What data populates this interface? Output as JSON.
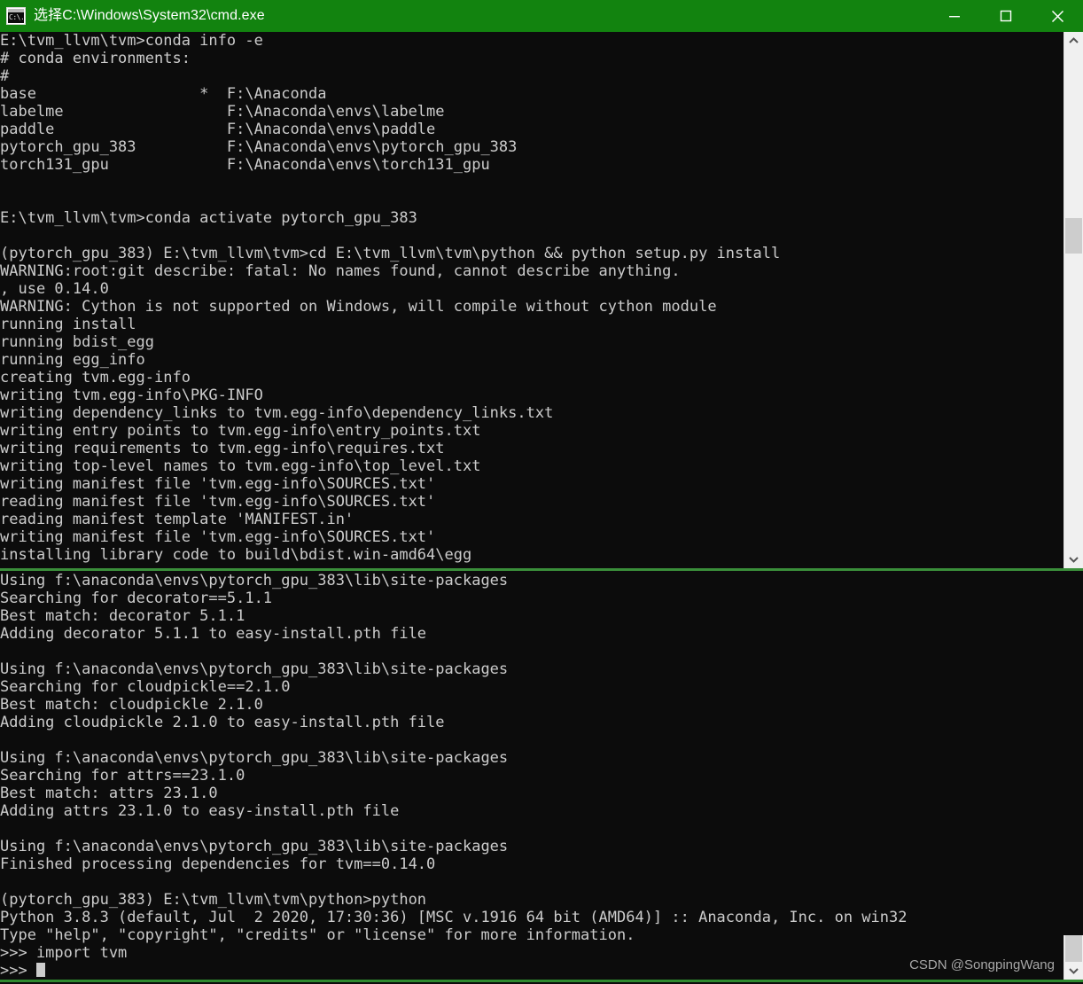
{
  "window": {
    "title": "选择C:\\Windows\\System32\\cmd.exe",
    "icon": "console-icon",
    "titlebar_color": "#12830f",
    "background_color": "#0c0c0c",
    "text_color": "#cccccc",
    "controls": [
      {
        "name": "minimize",
        "glyph": "minimize-icon"
      },
      {
        "name": "maximize",
        "glyph": "maximize-icon"
      },
      {
        "name": "close",
        "glyph": "close-icon"
      }
    ]
  },
  "divider": {
    "color": "#3a8f3a"
  },
  "scrollbars": {
    "top": {
      "up_arrow": "chevron-up-icon",
      "down_arrow": "chevron-down-icon",
      "thumb_position_pct": 36
    },
    "bottom": {
      "down_arrow": "chevron-down-icon"
    }
  },
  "watermark": {
    "text": "CSDN @SongpingWang"
  },
  "console_top": {
    "lines": [
      "E:\\tvm_llvm\\tvm>conda info -e",
      "# conda environments:",
      "#",
      "base                  *  F:\\Anaconda",
      "labelme                  F:\\Anaconda\\envs\\labelme",
      "paddle                   F:\\Anaconda\\envs\\paddle",
      "pytorch_gpu_383          F:\\Anaconda\\envs\\pytorch_gpu_383",
      "torch131_gpu             F:\\Anaconda\\envs\\torch131_gpu",
      "",
      "",
      "E:\\tvm_llvm\\tvm>conda activate pytorch_gpu_383",
      "",
      "(pytorch_gpu_383) E:\\tvm_llvm\\tvm>cd E:\\tvm_llvm\\tvm\\python && python setup.py install",
      "WARNING:root:git describe: fatal: No names found, cannot describe anything.",
      ", use 0.14.0",
      "WARNING: Cython is not supported on Windows, will compile without cython module",
      "running install",
      "running bdist_egg",
      "running egg_info",
      "creating tvm.egg-info",
      "writing tvm.egg-info\\PKG-INFO",
      "writing dependency_links to tvm.egg-info\\dependency_links.txt",
      "writing entry points to tvm.egg-info\\entry_points.txt",
      "writing requirements to tvm.egg-info\\requires.txt",
      "writing top-level names to tvm.egg-info\\top_level.txt",
      "writing manifest file 'tvm.egg-info\\SOURCES.txt'",
      "reading manifest file 'tvm.egg-info\\SOURCES.txt'",
      "reading manifest template 'MANIFEST.in'",
      "writing manifest file 'tvm.egg-info\\SOURCES.txt'",
      "installing library code to build\\bdist.win-amd64\\egg"
    ]
  },
  "console_bottom": {
    "lines": [
      "Using f:\\anaconda\\envs\\pytorch_gpu_383\\lib\\site-packages",
      "Searching for decorator==5.1.1",
      "Best match: decorator 5.1.1",
      "Adding decorator 5.1.1 to easy-install.pth file",
      "",
      "Using f:\\anaconda\\envs\\pytorch_gpu_383\\lib\\site-packages",
      "Searching for cloudpickle==2.1.0",
      "Best match: cloudpickle 2.1.0",
      "Adding cloudpickle 2.1.0 to easy-install.pth file",
      "",
      "Using f:\\anaconda\\envs\\pytorch_gpu_383\\lib\\site-packages",
      "Searching for attrs==23.1.0",
      "Best match: attrs 23.1.0",
      "Adding attrs 23.1.0 to easy-install.pth file",
      "",
      "Using f:\\anaconda\\envs\\pytorch_gpu_383\\lib\\site-packages",
      "Finished processing dependencies for tvm==0.14.0",
      "",
      "(pytorch_gpu_383) E:\\tvm_llvm\\tvm\\python>python",
      "Python 3.8.3 (default, Jul  2 2020, 17:30:36) [MSC v.1916 64 bit (AMD64)] :: Anaconda, Inc. on win32",
      "Type \"help\", \"copyright\", \"credits\" or \"license\" for more information.",
      ">>> import tvm"
    ],
    "prompt": ">>> "
  }
}
